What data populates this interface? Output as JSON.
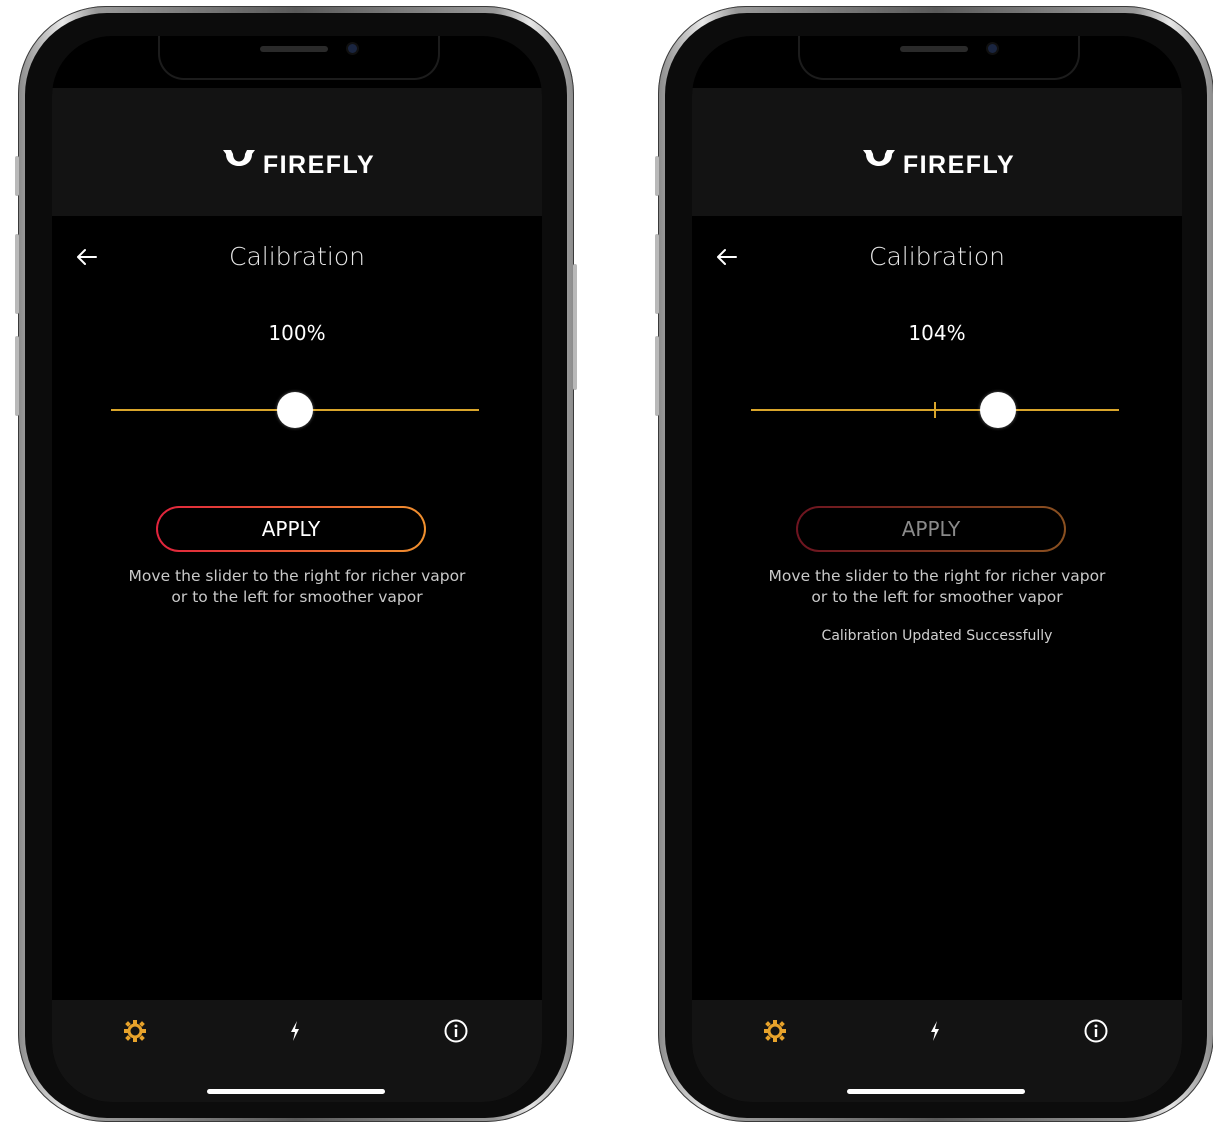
{
  "colors": {
    "accent": "#d9a52b",
    "apply_gradient_start": "#e0233c",
    "apply_gradient_end": "#f0902e",
    "screen_bg": "#000000",
    "bar_bg": "#131313"
  },
  "phones": [
    {
      "brand": "FIREFLY",
      "page_title": "Calibration",
      "back_icon": "arrow-left-icon",
      "calibration_value": "100%",
      "slider_value": 0.5,
      "slider_default_tick": 0.5,
      "apply_label": "APPLY",
      "apply_enabled": true,
      "hint_line1": "Move the slider to the right for richer vapor",
      "hint_line2": "or to the left for smoother vapor",
      "status_message": "",
      "tabs": [
        {
          "icon": "gear-icon",
          "active": true
        },
        {
          "icon": "bolt-icon",
          "active": false
        },
        {
          "icon": "info-icon",
          "active": false
        }
      ]
    },
    {
      "brand": "FIREFLY",
      "page_title": "Calibration",
      "back_icon": "arrow-left-icon",
      "calibration_value": "104%",
      "slider_value": 0.67,
      "slider_default_tick": 0.5,
      "apply_label": "APPLY",
      "apply_enabled": false,
      "hint_line1": "Move the slider to the right for richer vapor",
      "hint_line2": "or to the left for smoother vapor",
      "status_message": "Calibration Updated Successfully",
      "tabs": [
        {
          "icon": "gear-icon",
          "active": true
        },
        {
          "icon": "bolt-icon",
          "active": false
        },
        {
          "icon": "info-icon",
          "active": false
        }
      ]
    }
  ]
}
